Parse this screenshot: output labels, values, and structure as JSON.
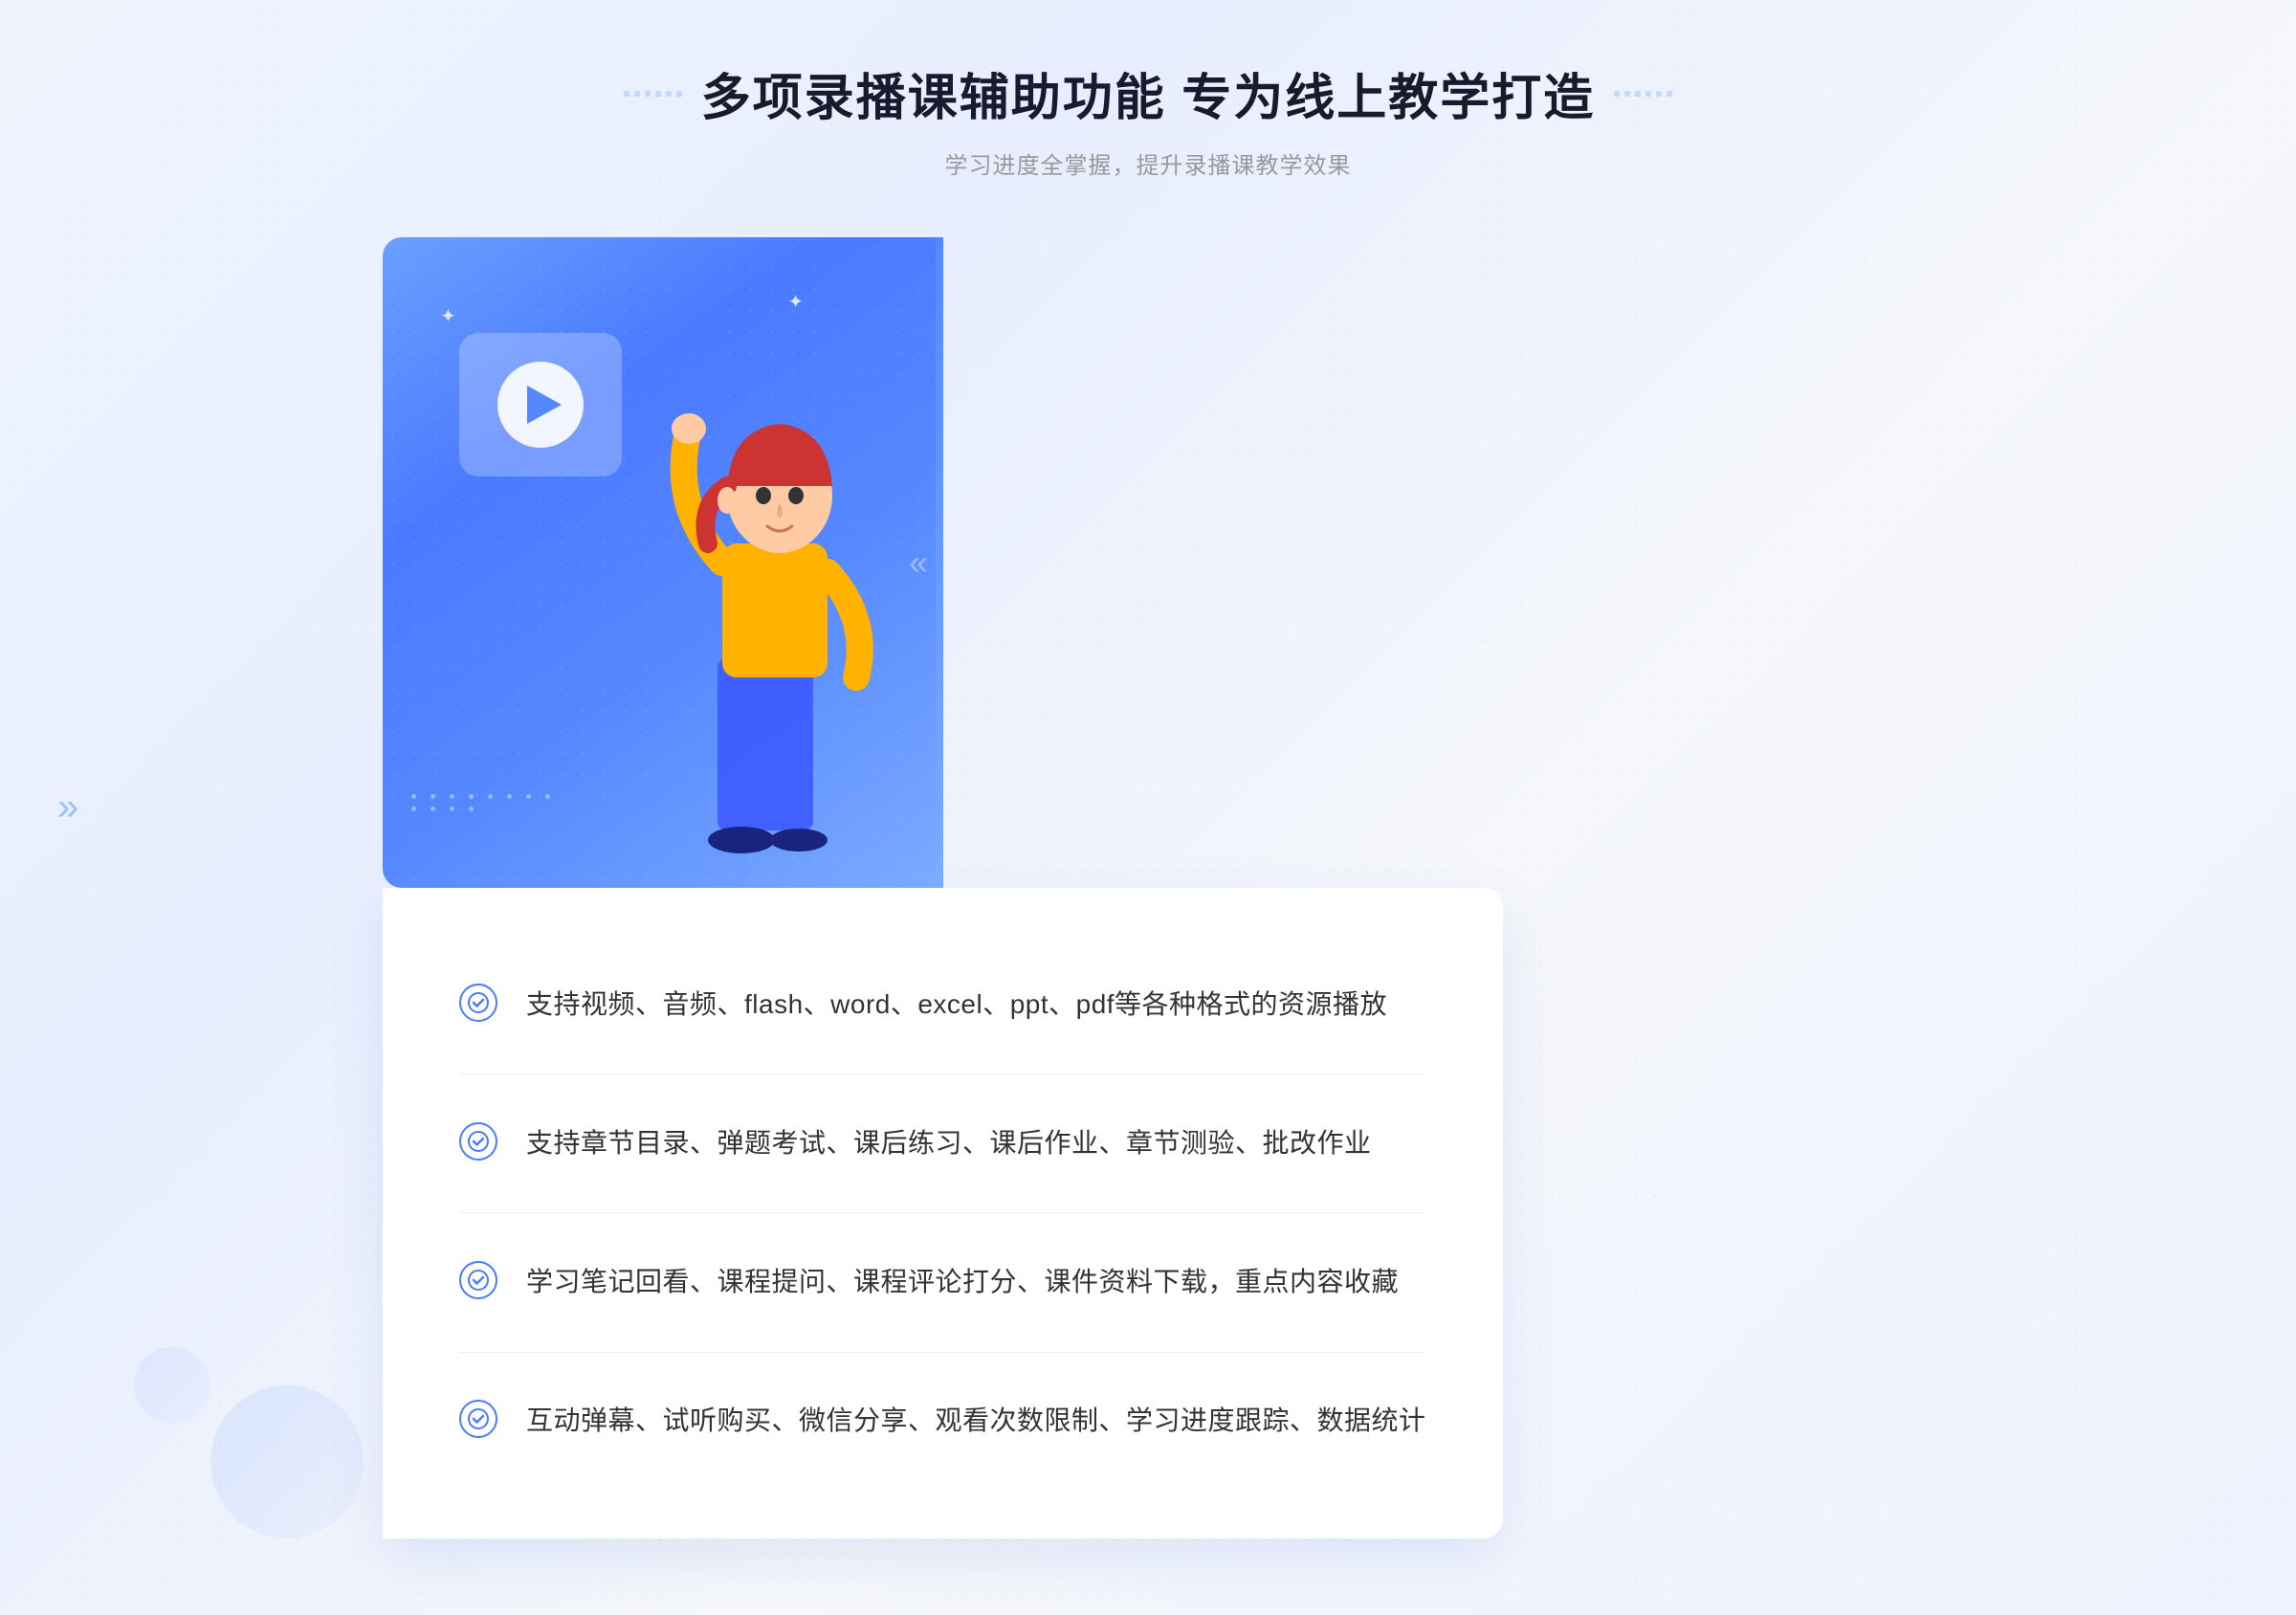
{
  "header": {
    "title": "多项录播课辅助功能 专为线上教学打造",
    "subtitle": "学习进度全掌握，提升录播课教学效果",
    "title_deco_left": ":::::",
    "title_deco_right": ":::::"
  },
  "features": [
    {
      "id": 1,
      "text": "支持视频、音频、flash、word、excel、ppt、pdf等各种格式的资源播放"
    },
    {
      "id": 2,
      "text": "支持章节目录、弹题考试、课后练习、课后作业、章节测验、批改作业"
    },
    {
      "id": 3,
      "text": "学习笔记回看、课程提问、课程评论打分、课件资料下载，重点内容收藏"
    },
    {
      "id": 4,
      "text": "互动弹幕、试听购买、微信分享、观看次数限制、学习进度跟踪、数据统计"
    }
  ],
  "icons": {
    "check": "✓",
    "play": "▶",
    "arrows_left": "»",
    "arrows_right": ":::::"
  },
  "colors": {
    "primary": "#4a7aff",
    "text_dark": "#1a1a2e",
    "text_gray": "#999999",
    "text_body": "#333333",
    "bg_light": "#f5f7fa",
    "white": "#ffffff"
  }
}
